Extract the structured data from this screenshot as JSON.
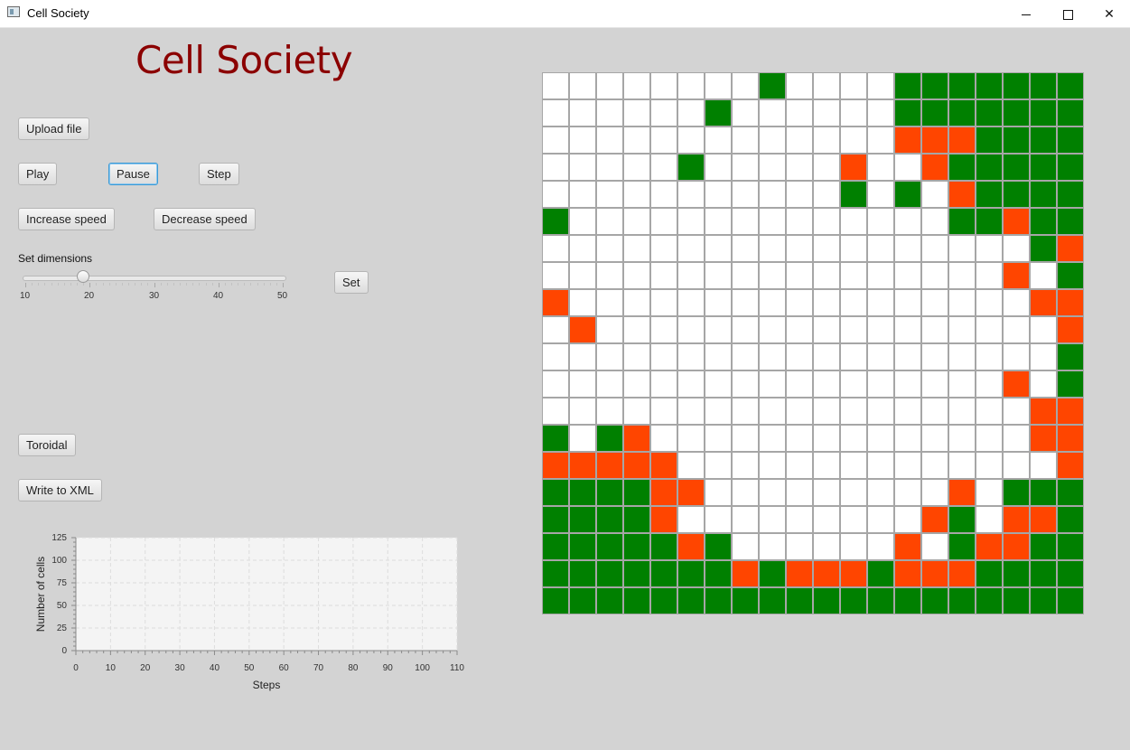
{
  "window": {
    "title": "Cell Society"
  },
  "app": {
    "title": "Cell Society"
  },
  "buttons": {
    "upload": "Upload file",
    "play": "Play",
    "pause": "Pause",
    "step": "Step",
    "increase": "Increase speed",
    "decrease": "Decrease speed",
    "set": "Set",
    "toroidal": "Toroidal",
    "write_xml": "Write to XML"
  },
  "dimensions": {
    "label": "Set dimensions",
    "min": 10,
    "max": 50,
    "value": 19,
    "ticks": [
      "10",
      "20",
      "30",
      "40",
      "50"
    ]
  },
  "colors": {
    "empty": "#ffffff",
    "green": "#008000",
    "orange": "#ff4500"
  },
  "grid": {
    "size": 20,
    "legend": {
      "W": "empty",
      "G": "green",
      "O": "orange"
    },
    "rows": [
      "WWWWWWWWGWWWWGGGGGGG",
      "WWWWWWGWWWWWWGGGGGGG",
      "WWWWWWWWWWWWWOOOGGGG",
      "WWWWWGWWWWWOWWOGGGGG",
      "WWWWWWWWWWWGWGWOGGGG",
      "GWWWWWWWWWWWWWWGGOGG",
      "WWWWWWWWWWWWWWWWWWGO",
      "WWWWWWWWWWWWWWWWWOWG",
      "OWWWWWWWWWWWWWWWWWOO",
      "WOWWWWWWWWWWWWWWWWWO",
      "WWWWWWWWWWWWWWWWWWWG",
      "WWWWWWWWWWWWWWWWWOWG",
      "WWWWWWWWWWWWWWWWWWOO",
      "GWGOWWWWWWWWWWWWWWOO",
      "OOOOOWWWWWWWWWWWWWWO",
      "GGGGOOWWWWWWWWWOWGGG",
      "GGGGOWWWWWWWWWOGWOOG",
      "GGGGGOGWWWWWWOWGOOGG",
      "GGGGGGGOGOOOGOOOGGGG",
      "GGGGGGGGGGGGGGGGGGGG"
    ]
  },
  "chart_data": {
    "type": "line",
    "title": "",
    "xlabel": "Steps",
    "ylabel": "Number of cells",
    "xlim": [
      0,
      110
    ],
    "ylim": [
      0,
      125
    ],
    "xticks": [
      "0",
      "10",
      "20",
      "30",
      "40",
      "50",
      "60",
      "70",
      "80",
      "90",
      "100",
      "110"
    ],
    "yticks": [
      "0",
      "25",
      "50",
      "75",
      "100",
      "125"
    ],
    "grid": true,
    "series": []
  }
}
